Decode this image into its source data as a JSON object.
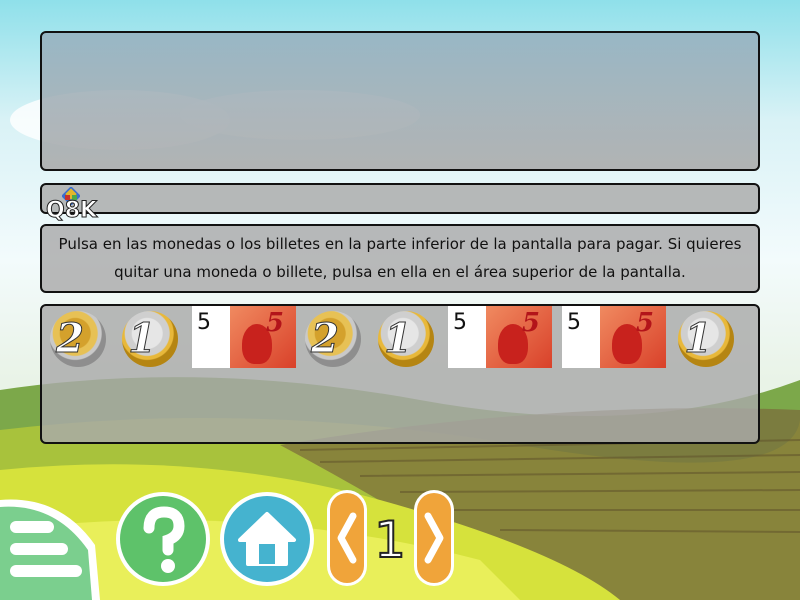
{
  "score": {
    "value": "Q8K"
  },
  "instruction": {
    "text": "Pulsa en las monedas o los billetes en la parte inferior de la pantalla para pagar. Si quieres quitar una moneda o billete, pulsa en ella en el área superior de la pantalla."
  },
  "money_tray": {
    "items": [
      {
        "type": "coin",
        "value": "2"
      },
      {
        "type": "coin",
        "value": "1"
      },
      {
        "type": "bill",
        "value": "5"
      },
      {
        "type": "coin",
        "value": "2"
      },
      {
        "type": "coin",
        "value": "1"
      },
      {
        "type": "bill",
        "value": "5"
      },
      {
        "type": "bill",
        "value": "5"
      },
      {
        "type": "coin",
        "value": "1"
      }
    ]
  },
  "controls": {
    "level": "1",
    "icons": {
      "menu": "menu-icon",
      "help": "help-icon",
      "home": "home-icon",
      "previous": "chevron-left-icon",
      "next": "chevron-right-icon"
    }
  },
  "colors": {
    "help_green": "#5ec26a",
    "home_blue": "#45b3cf",
    "nav_orange": "#f0a43a",
    "panel_gray": "#aaaaaa"
  }
}
